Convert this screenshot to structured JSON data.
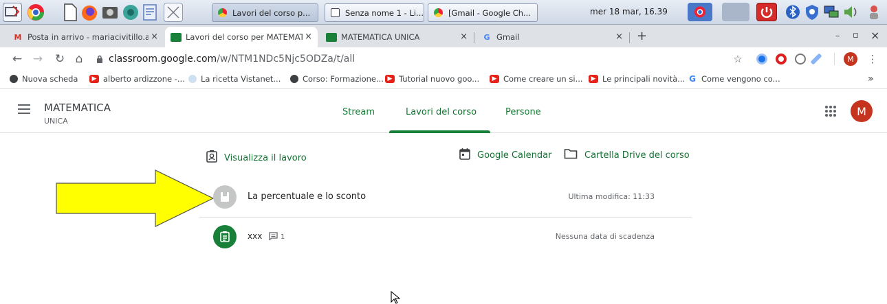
{
  "taskbar": {
    "tasks": [
      {
        "label": "Lavori del corso p..."
      },
      {
        "label": "Senza nome 1 - Li..."
      },
      {
        "label": "[Gmail - Google Ch..."
      }
    ],
    "clock": "mer 18 mar, 16.39"
  },
  "browser_tabs": [
    {
      "label": "Posta in arrivo - mariacivitillo.al"
    },
    {
      "label": "Lavori del corso per MATEMATI"
    },
    {
      "label": "MATEMATICA UNICA"
    },
    {
      "label": "Gmail"
    }
  ],
  "new_tab_label": "+",
  "window_controls": {
    "minimize": "–",
    "maximize": "▫",
    "close": "×"
  },
  "address": {
    "host": "classroom.google.com",
    "path": "/w/NTM1NDc5Njc5ODZa/t/all"
  },
  "avatar_letter": "M",
  "bookmarks": [
    {
      "label": "Nuova scheda"
    },
    {
      "label": "alberto ardizzone -..."
    },
    {
      "label": "La ricetta Vistanet..."
    },
    {
      "label": "Corso: Formazione..."
    },
    {
      "label": "Tutorial nuovo goo..."
    },
    {
      "label": "Come creare un si..."
    },
    {
      "label": "Le principali novità..."
    },
    {
      "label": "Come vengono co..."
    }
  ],
  "bookmarks_more": "»",
  "classroom": {
    "class_name": "MATEMATICA",
    "class_section": "UNICA",
    "tabs": [
      "Stream",
      "Lavori del corso",
      "Persone"
    ],
    "active_tab": "Lavori del corso",
    "view_work": "Visualizza il lavoro",
    "google_calendar": "Google Calendar",
    "drive_folder": "Cartella Drive del corso",
    "items": [
      {
        "title": "La percentuale e lo sconto",
        "meta": "Ultima modifica: 11:33",
        "comment_count": ""
      },
      {
        "title": "xxx",
        "meta": "Nessuna data di scadenza",
        "comment_count": "1"
      }
    ]
  },
  "colors": {
    "classroom_green": "#188038",
    "avatar_red": "#c5341f",
    "arrow_yellow": "#ffff00"
  }
}
